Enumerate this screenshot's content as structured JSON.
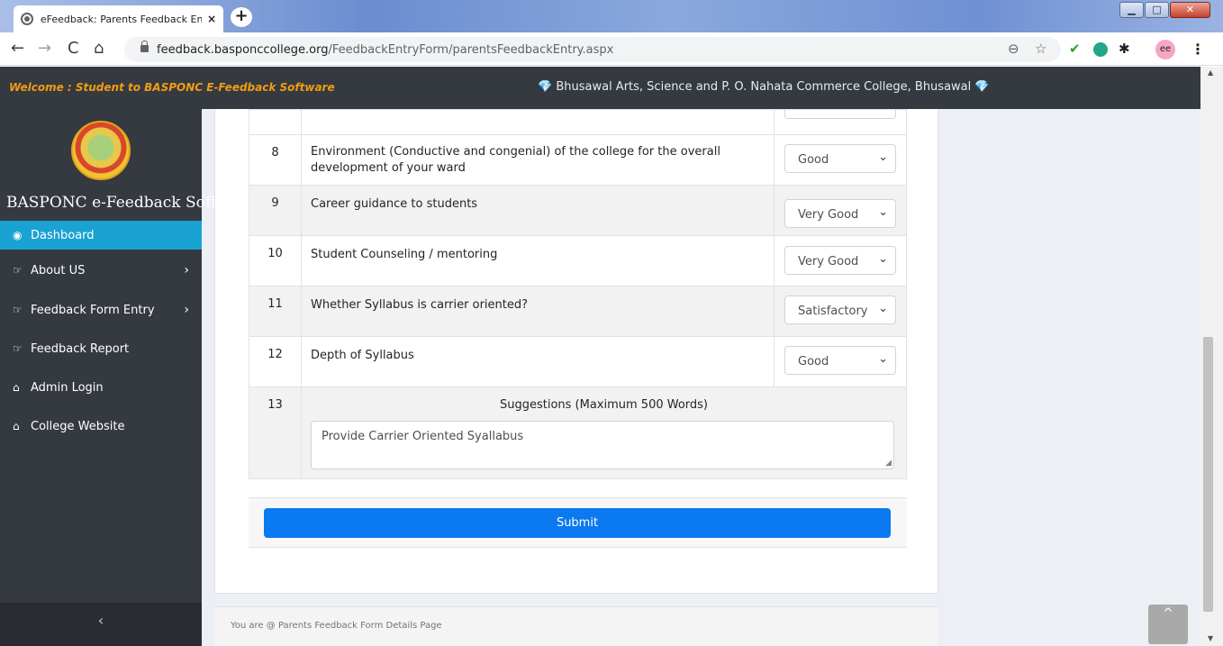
{
  "browser": {
    "tab_title": "eFeedback: Parents Feedback Ent",
    "tab_close": "×",
    "new_tab": "+",
    "url_domain": "feedback.basponccollege.org",
    "url_path": "/FeedbackEntryForm/parentsFeedbackEntry.aspx",
    "window_controls": {
      "minimize": "▁",
      "maximize": "□",
      "close": "✕"
    },
    "nav": {
      "back": "←",
      "forward": "→",
      "reload": "C",
      "home": "⌂"
    },
    "toolbar_icons": {
      "zoom": "⊖",
      "star": "☆",
      "check": "✔",
      "puzzle": "✱",
      "menu": "⋮",
      "avatar": "ee"
    }
  },
  "header": {
    "welcome": "Welcome : Student to BASPONC E-Feedback Software",
    "college": "Bhusawal Arts, Science and P. O. Nahata Commerce College, Bhusawal",
    "gem": "💎"
  },
  "sidebar": {
    "brand": "BASPONC e-Feedback Soft",
    "items": [
      {
        "label": "Dashboard",
        "icon": "dashboard-icon",
        "glyph": "◉",
        "active": true
      },
      {
        "label": "About US",
        "icon": "hand-pointer-icon",
        "glyph": "☞",
        "chevron": "›"
      },
      {
        "label": "Feedback Form Entry",
        "icon": "hand-pointer-icon",
        "glyph": "☞",
        "chevron": "›"
      },
      {
        "label": "Feedback Report",
        "icon": "hand-pointer-icon",
        "glyph": "☞"
      },
      {
        "label": "Admin Login",
        "icon": "home-icon",
        "glyph": "⌂"
      },
      {
        "label": "College Website",
        "icon": "home-icon",
        "glyph": "⌂"
      }
    ],
    "collapse": "‹"
  },
  "questions": [
    {
      "num": "8",
      "text": "Environment (Conductive and congenial) of the college for the overall development of your ward",
      "value": "Good"
    },
    {
      "num": "9",
      "text": "Career guidance to students",
      "value": "Very Good"
    },
    {
      "num": "10",
      "text": "Student Counseling / mentoring",
      "value": "Very Good"
    },
    {
      "num": "11",
      "text": "Whether Syllabus is carrier oriented?",
      "value": "Satisfactory"
    },
    {
      "num": "12",
      "text": "Depth of Syllabus",
      "value": "Good"
    }
  ],
  "suggestion": {
    "num": "13",
    "title": "Suggestions (Maximum 500 Words)",
    "value": "Provide Carrier Oriented Syallabus"
  },
  "submit_label": "Submit",
  "footer_text": "You are @ Parents Feedback Form Details Page",
  "back_to_top": "^",
  "select_caret": "⌄",
  "colors": {
    "accent": "#f39c12",
    "active_menu": "#1aa2d3",
    "submit": "#0b79f0",
    "sidebar": "#343a40"
  }
}
